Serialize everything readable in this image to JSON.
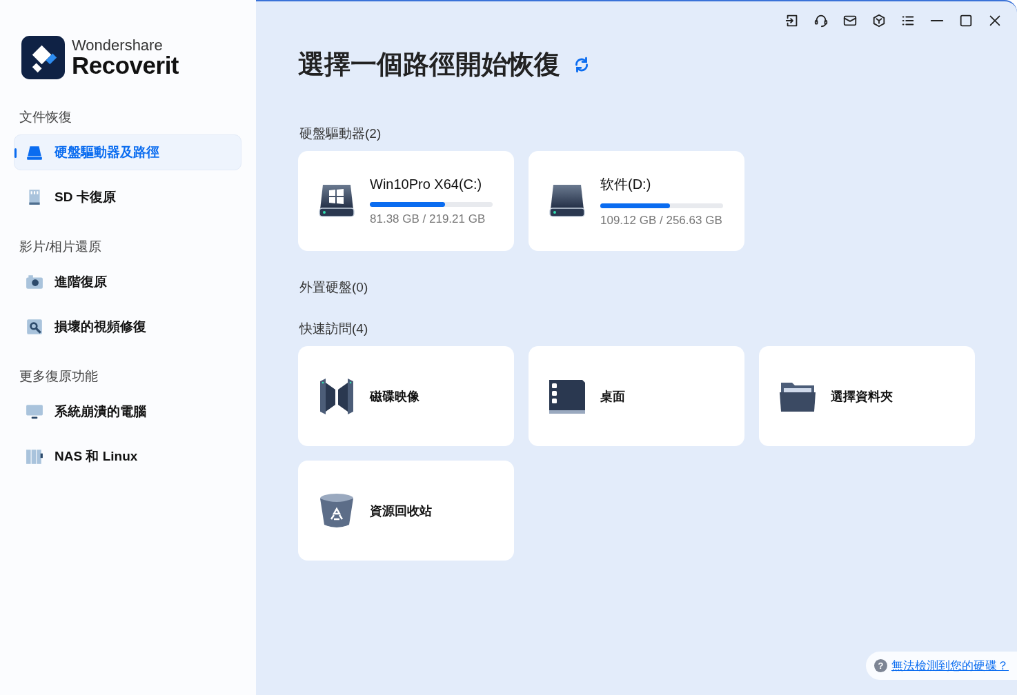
{
  "brand": {
    "company": "Wondershare",
    "product": "Recoverit"
  },
  "sidebar": {
    "sections": [
      {
        "title": "文件恢復",
        "items": [
          {
            "label": "硬盤驅動器及路徑",
            "kind": "drive",
            "selected": true
          },
          {
            "label": "SD 卡復原",
            "kind": "sdcard",
            "selected": false
          }
        ]
      },
      {
        "title": "影片/相片還原",
        "items": [
          {
            "label": "進階復原",
            "kind": "camera",
            "selected": false
          },
          {
            "label": "損壞的視頻修復",
            "kind": "repair",
            "selected": false
          }
        ]
      },
      {
        "title": "更多復原功能",
        "items": [
          {
            "label": "系統崩潰的電腦",
            "kind": "monitor",
            "selected": false
          },
          {
            "label": "NAS 和 Linux",
            "kind": "nas",
            "selected": false
          }
        ]
      }
    ]
  },
  "toolbar": [
    {
      "kind": "login"
    },
    {
      "kind": "support"
    },
    {
      "kind": "mail"
    },
    {
      "kind": "package"
    },
    {
      "kind": "menu"
    },
    {
      "kind": "minimize"
    },
    {
      "kind": "maximize"
    },
    {
      "kind": "close"
    }
  ],
  "heading": "選擇一個路徑開始恢復",
  "hard_drives": {
    "title": "硬盤驅動器(2)",
    "drives": [
      {
        "name": "Win10Pro X64(C:)",
        "kind": "system",
        "level": 0.61,
        "usage": "81.38 GB / 219.21 GB"
      },
      {
        "name": "软件(D:)",
        "kind": "plain",
        "level": 0.57,
        "usage": "109.12 GB / 256.63 GB"
      }
    ]
  },
  "external_drives": {
    "title": "外置硬盤(0)"
  },
  "quick_access": {
    "title": "快速訪問(4)",
    "items": [
      {
        "label": "磁碟映像",
        "kind": "image"
      },
      {
        "label": "桌面",
        "kind": "desktop"
      },
      {
        "label": "選擇資料夾",
        "kind": "folder"
      },
      {
        "label": "資源回收站",
        "kind": "bin"
      }
    ]
  },
  "help": {
    "icon_glyph": "?",
    "link": "無法檢測到您的硬碟？"
  }
}
